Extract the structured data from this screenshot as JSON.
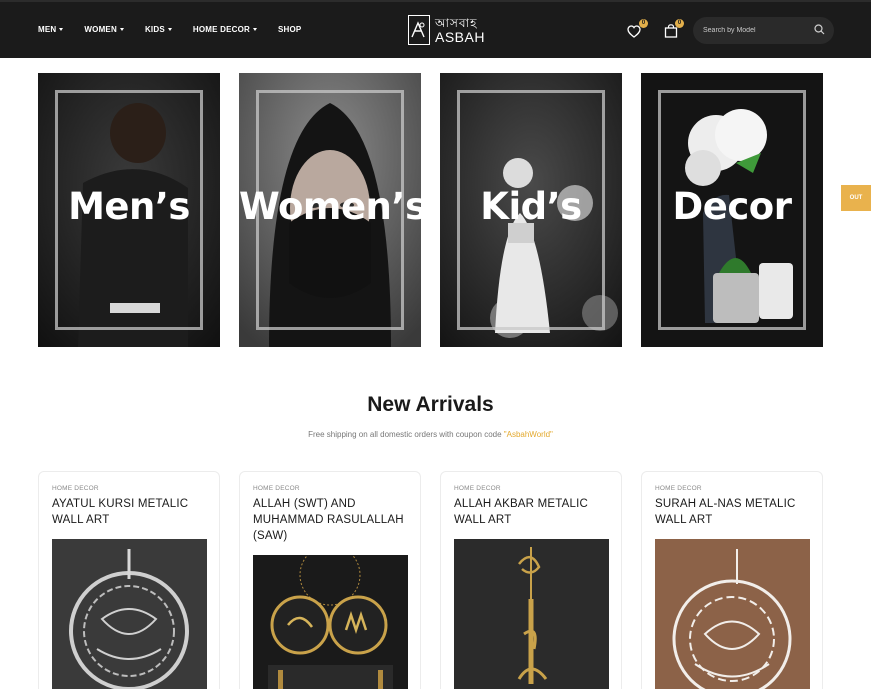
{
  "header": {
    "nav": [
      {
        "label": "MEN",
        "has_dropdown": true
      },
      {
        "label": "WOMEN",
        "has_dropdown": true
      },
      {
        "label": "KIDS",
        "has_dropdown": true
      },
      {
        "label": "HOME DECOR",
        "has_dropdown": true
      },
      {
        "label": "SHOP",
        "has_dropdown": false
      }
    ],
    "logo": {
      "script": "আসবাহ",
      "name": "ASBAH"
    },
    "wishlist_count": "0",
    "cart_count": "0",
    "search_placeholder": "Search by Model"
  },
  "categories": [
    {
      "label": "Men’s"
    },
    {
      "label": "Women’s"
    },
    {
      "label": "Kid’s"
    },
    {
      "label": "Decor"
    }
  ],
  "side_tab": {
    "label": "OUT"
  },
  "new_arrivals": {
    "title": "New Arrivals",
    "subtitle_prefix": "Free shipping on all domestic orders with coupon code ",
    "coupon_code": "\"AsbahWorld\""
  },
  "products": [
    {
      "category": "HOME DECOR",
      "title": "AYATUL KURSI METALIC WALL ART"
    },
    {
      "category": "HOME DECOR",
      "title": "ALLAH (SWT) AND MUHAMMAD RASULALLAH (SAW)"
    },
    {
      "category": "HOME DECOR",
      "title": "ALLAH AKBAR METALIC WALL ART"
    },
    {
      "category": "HOME DECOR",
      "title": "SURAH AL-NAS METALIC WALL ART"
    }
  ],
  "colors": {
    "header_bg": "#1b1b1b",
    "accent": "#e3b04b",
    "side_tab": "#e9b24d"
  }
}
